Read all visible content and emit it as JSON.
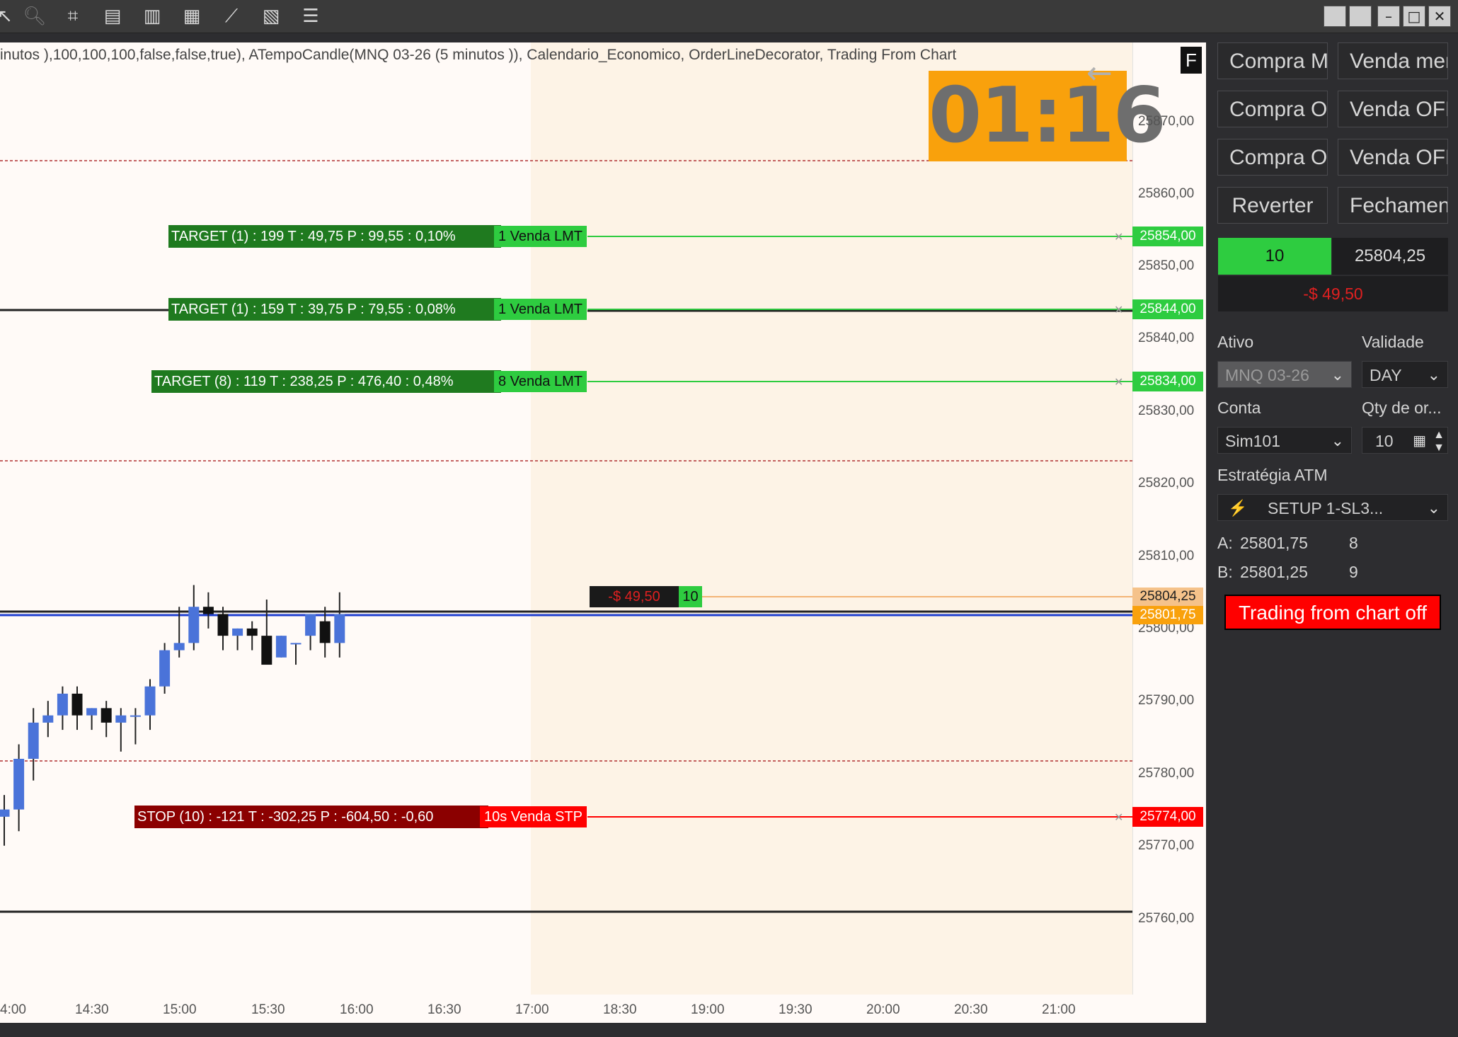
{
  "chart": {
    "title": "inutos ),100,100,100,false,false,true), ATempoCandle(MNQ 03-26 (5 minutos )), Calendario_Economico, OrderLineDecorator, Trading From Chart",
    "f_button": "F",
    "timer": "01:16",
    "price_ticks": [
      "25870,00",
      "25860,00",
      "25850,00",
      "25840,00",
      "25830,00",
      "25820,00",
      "25810,00",
      "25800,00",
      "25790,00",
      "25780,00",
      "25770,00",
      "25760,00"
    ],
    "time_ticks": [
      "4:00",
      "14:30",
      "15:00",
      "15:30",
      "16:00",
      "16:30",
      "17:00",
      "18:30",
      "19:00",
      "19:30",
      "20:00",
      "20:30",
      "21:00"
    ],
    "orders": [
      {
        "label": "TARGET (1)  :  199 T  :  49,75 P  :   99,55  :  0,10%",
        "tag": "1 Venda LMT",
        "price": "25854,00",
        "color": "#1f7a1f"
      },
      {
        "label": "TARGET (1)  :  159 T  :  39,75 P  :   79,55  :  0,08%",
        "tag": "1 Venda LMT",
        "price": "25844,00",
        "color": "#1f7a1f"
      },
      {
        "label": "TARGET (8)  :  119 T  :  238,25 P  :   476,40  :  0,48%",
        "tag": "8 Venda LMT",
        "price": "25834,00",
        "color": "#1f7a1f"
      },
      {
        "label": "STOP (10)  :  -121 T  :  -302,25 P  :   -604,50  :  -0,60",
        "tag": "10s Venda STP",
        "price": "25774,00",
        "color": "#8b0000"
      }
    ],
    "position": {
      "pnl": "-$ 49,50",
      "qty": "10",
      "last_price": "25804,25",
      "avg_price": "25801,75"
    }
  },
  "panel": {
    "buttons": [
      {
        "label": "Compra MKT"
      },
      {
        "label": "Venda mercado"
      },
      {
        "label": "Compra OFR"
      },
      {
        "label": "Venda OFR"
      },
      {
        "label": "Compra OFR"
      },
      {
        "label": "Venda OFR"
      },
      {
        "label": "Reverter"
      },
      {
        "label": "Fechamento"
      }
    ],
    "position_qty": "10",
    "position_price": "25804,25",
    "pnl": "-$ 49,50",
    "ativo_label": "Ativo",
    "ativo_value": "MNQ 03-26",
    "validade_label": "Validade",
    "validade_value": "DAY",
    "conta_label": "Conta",
    "conta_value": "Sim101",
    "qty_label": "Qty de or...",
    "qty_value": "10",
    "atm_label": "Estratégia ATM",
    "atm_value": "SETUP 1-SL3...",
    "ask_label": "A:",
    "ask_price": "25801,75",
    "ask_size": "8",
    "bid_label": "B:",
    "bid_price": "25801,25",
    "bid_size": "9",
    "trading_toggle": "Trading from chart off"
  },
  "colors": {
    "green": "#2ecc40",
    "red": "#ff0000",
    "orange": "#f9a10c",
    "blue": "#4a73d9"
  },
  "chart_data": {
    "type": "candlestick",
    "candles": [
      {
        "open": 25774,
        "high": 25777,
        "low": 25770,
        "close": 25775
      },
      {
        "open": 25775,
        "high": 25784,
        "low": 25772,
        "close": 25782
      },
      {
        "open": 25782,
        "high": 25789,
        "low": 25779,
        "close": 25787
      },
      {
        "open": 25787,
        "high": 25790,
        "low": 25785,
        "close": 25788
      },
      {
        "open": 25788,
        "high": 25792,
        "low": 25786,
        "close": 25791
      },
      {
        "open": 25791,
        "high": 25792,
        "low": 25786,
        "close": 25788
      },
      {
        "open": 25788,
        "high": 25789,
        "low": 25786,
        "close": 25789
      },
      {
        "open": 25789,
        "high": 25790,
        "low": 25785,
        "close": 25787
      },
      {
        "open": 25787,
        "high": 25789,
        "low": 25783,
        "close": 25788
      },
      {
        "open": 25788,
        "high": 25789,
        "low": 25784,
        "close": 25788
      },
      {
        "open": 25788,
        "high": 25793,
        "low": 25786,
        "close": 25792
      },
      {
        "open": 25792,
        "high": 25798,
        "low": 25791,
        "close": 25797
      },
      {
        "open": 25797,
        "high": 25803,
        "low": 25796,
        "close": 25798
      },
      {
        "open": 25798,
        "high": 25806,
        "low": 25797,
        "close": 25803
      },
      {
        "open": 25803,
        "high": 25805,
        "low": 25800,
        "close": 25802
      },
      {
        "open": 25802,
        "high": 25803,
        "low": 25797,
        "close": 25799
      },
      {
        "open": 25799,
        "high": 25800,
        "low": 25797,
        "close": 25800
      },
      {
        "open": 25800,
        "high": 25801,
        "low": 25797,
        "close": 25799
      },
      {
        "open": 25799,
        "high": 25804,
        "low": 25795,
        "close": 25795
      },
      {
        "open": 25796,
        "high": 25799,
        "low": 25796,
        "close": 25799
      },
      {
        "open": 25798,
        "high": 25798,
        "low": 25795,
        "close": 25798
      },
      {
        "open": 25799,
        "high": 25802,
        "low": 25797,
        "close": 25802
      },
      {
        "open": 25801,
        "high": 25803,
        "low": 25796,
        "close": 25798
      },
      {
        "open": 25798,
        "high": 25805,
        "low": 25796,
        "close": 25802
      }
    ],
    "ylim": [
      25756,
      25875
    ]
  }
}
